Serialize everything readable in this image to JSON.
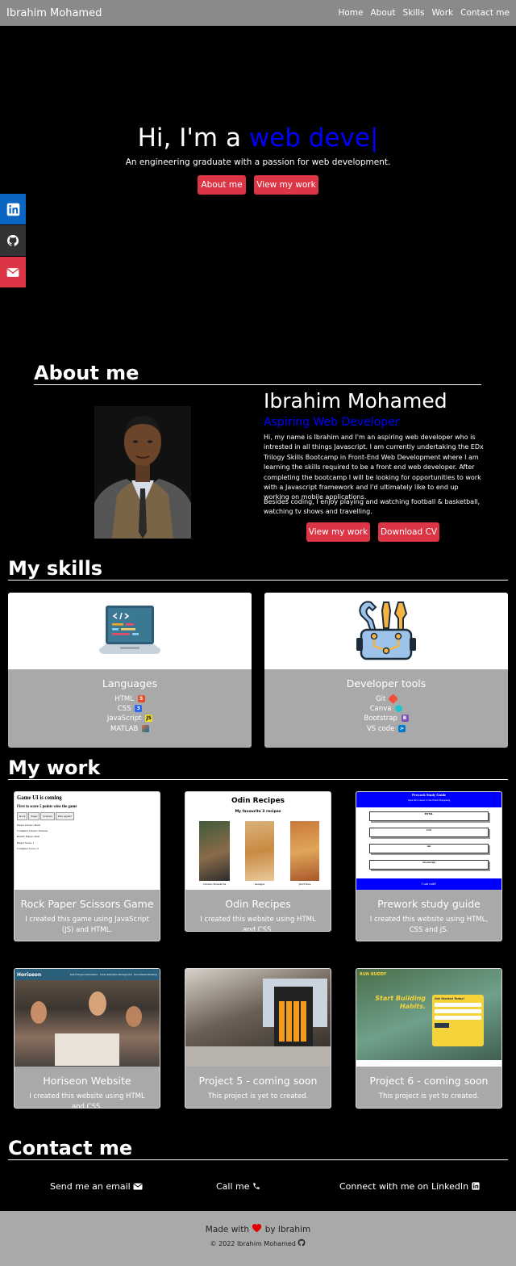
{
  "nav": {
    "brand": "Ibrahim Mohamed",
    "links": [
      "Home",
      "About",
      "Skills",
      "Work",
      "Contact me"
    ]
  },
  "social": [
    "linkedin-icon",
    "github-icon",
    "envelope-icon"
  ],
  "hero": {
    "title_prefix": "Hi, I'm a",
    "title_typed": "web deve|",
    "subtitle": "An engineering graduate with a passion for web development.",
    "btn_about": "About me",
    "btn_work": "View my work"
  },
  "about": {
    "heading": "About me",
    "name": "Ibrahim Mohamed",
    "role": "Aspiring Web Developer",
    "p1": "Hi, my name is Ibrahim and I'm an aspiring web developer who is intrested in all things Javascript. I am currently undertaking the EDx Trilogy Skills Bootcamp in Front-End Web Development where I am learning the skills required to be a front end web developer. After completing the bootcamp I will be looking for opportunities to work with a Javascript framework and I'd ultimately like to end up working on mobile applications.",
    "p2": "Besides coding, I enjoy playing and watching football & basketball, watching tv shows and travelling.",
    "btn_work": "View my work",
    "btn_cv": "Download CV"
  },
  "skills": {
    "heading": "My skills",
    "cards": [
      {
        "title": "Languages",
        "items": [
          "HTML",
          "CSS",
          "JavaScript",
          "MATLAB"
        ]
      },
      {
        "title": "Developer tools",
        "items": [
          "Git",
          "Canva",
          "Bootstrap",
          "VS code"
        ]
      }
    ]
  },
  "work": {
    "heading": "My work",
    "cards": [
      {
        "title": "Rock Paper Scissors Game",
        "desc": "I created this game using JavaScript (JS) and HTML."
      },
      {
        "title": "Odin Recipes",
        "desc": "I created this website using HTML and CSS."
      },
      {
        "title": "Prework study guide",
        "desc": "I created this website using HTML, CSS and JS."
      },
      {
        "title": "Horiseon Website",
        "desc": "I created this website using HTML and CSS."
      },
      {
        "title": "Project 5 - coming soon",
        "desc": "This project is yet to created."
      },
      {
        "title": "Project 6 - coming soon",
        "desc": "This project is yet to created."
      }
    ],
    "thumbs": {
      "rps": {
        "heading": "Game UI is coming",
        "sub": "First to score 5 points wins the game",
        "buttons": [
          "Rock",
          "Paper",
          "Scissors",
          "Play Again?"
        ],
        "lines": [
          "Player Choice: Rock",
          "Computer Choice: Scissors",
          "Result: Player wins!",
          "Player Score: 1",
          "Computer Score: 0"
        ]
      },
      "odin": {
        "heading": "Odin Recipes",
        "sub": "My favourite 3 recipes",
        "captions": [
          "Chicken Shawarma",
          "Lasagne",
          "Jollof Rice"
        ]
      },
      "prework": {
        "heading": "Prework Study Guide",
        "sub": "Open the Console to See What's Happening",
        "sections": [
          "HTML",
          "CSS",
          "Git",
          "JavaScript"
        ],
        "footer": "I can code!"
      },
      "horiseon": {
        "brand": "Horiseon",
        "links": [
          "Search Engine Optimization",
          "Online Reputation Management",
          "Social Media Marketing"
        ]
      },
      "run": {
        "brand": "RUN BUDDY",
        "headline": "Start Building Habits.",
        "form_title": "Get Started Today!"
      }
    }
  },
  "contact": {
    "heading": "Contact me",
    "email": "Send me an email",
    "call": "Call me",
    "linkedin": "Connect with me on LinkedIn"
  },
  "footer": {
    "made_prefix": "Made with",
    "made_suffix": "by Ibrahim",
    "copyright": "© 2022 Ibrahim Mohamed"
  },
  "colors": {
    "accent": "#0000ff",
    "button": "#dc3545",
    "card": "#a9a9a9",
    "nav": "#8a8a8a",
    "linkedin": "#0a66c2"
  }
}
